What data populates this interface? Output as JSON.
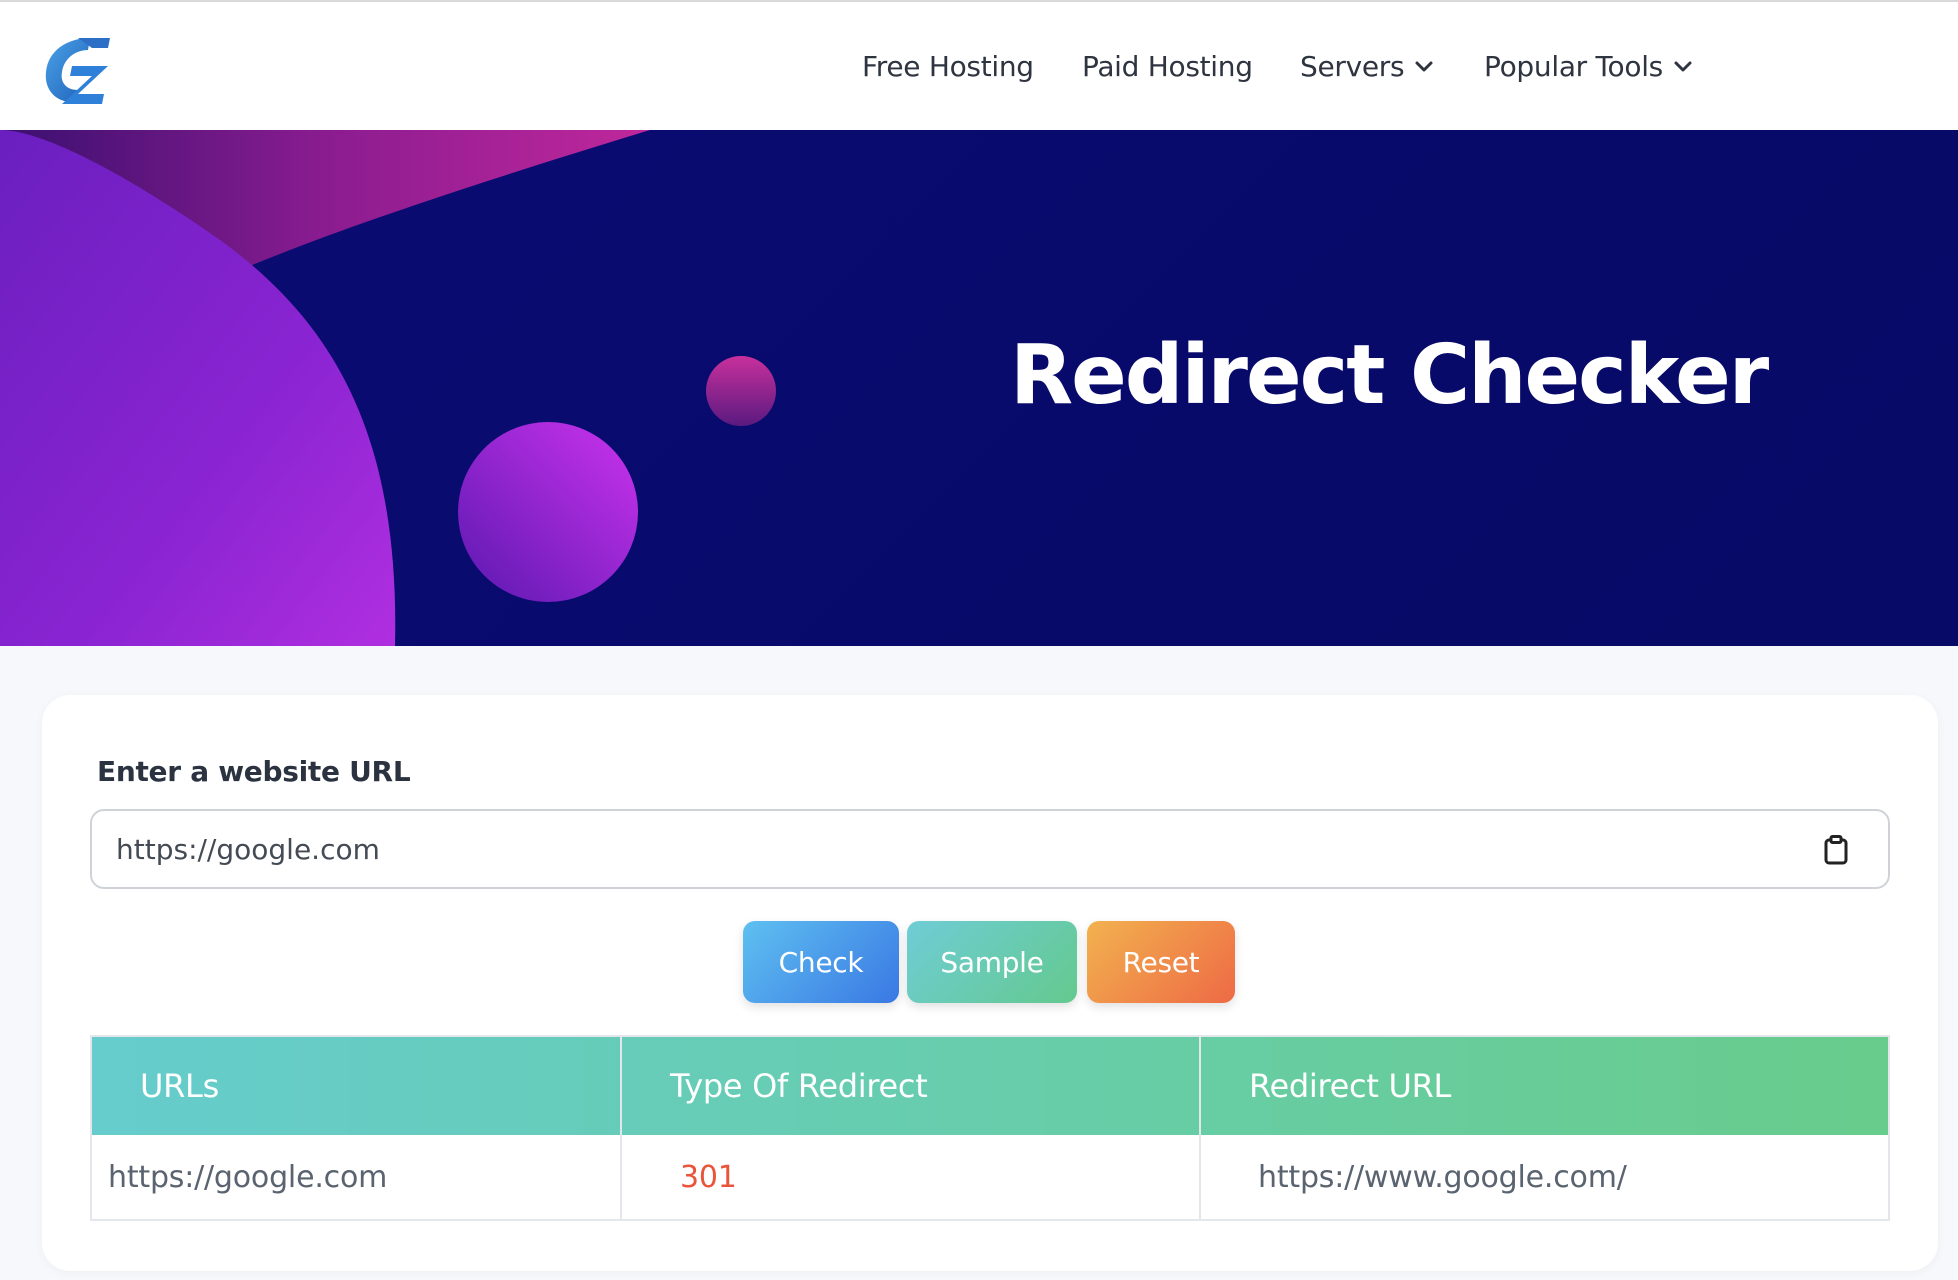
{
  "nav": {
    "logo": "site-logo",
    "items": [
      {
        "label": "Free Hosting",
        "dropdown": false
      },
      {
        "label": "Paid Hosting",
        "dropdown": false
      },
      {
        "label": "Servers",
        "dropdown": true
      },
      {
        "label": "Popular Tools",
        "dropdown": true
      }
    ]
  },
  "hero": {
    "title": "Redirect Checker"
  },
  "form": {
    "label": "Enter a website URL",
    "url_value": "https://google.com",
    "clipboard_icon": "clipboard-icon",
    "buttons": {
      "check": "Check",
      "sample": "Sample",
      "reset": "Reset"
    }
  },
  "results": {
    "headers": [
      "URLs",
      "Type Of Redirect",
      "Redirect URL"
    ],
    "rows": [
      {
        "url": "https://google.com",
        "type": "301",
        "redirect_url": "https://www.google.com/"
      }
    ]
  },
  "colors": {
    "hero_bg": "#080a6b",
    "status_code": "#e8553a",
    "table_header": "#66cc9e"
  }
}
